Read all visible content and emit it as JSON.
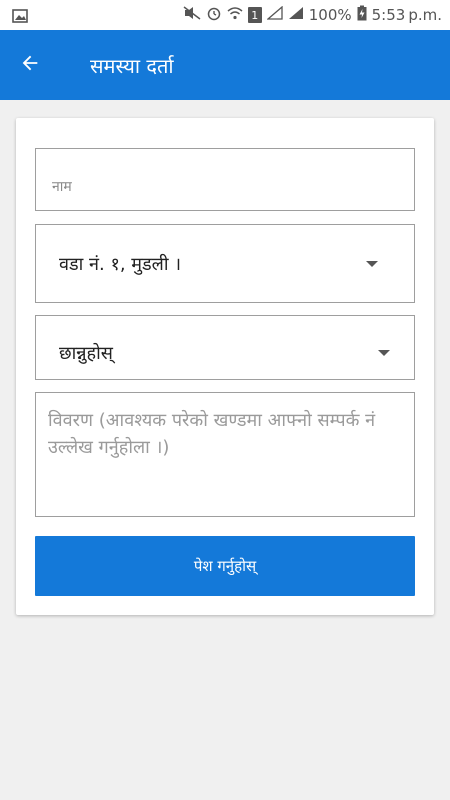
{
  "status_bar": {
    "battery_percent": "100%",
    "time": "5:53",
    "ampm": "p.m.",
    "sim_label": "1",
    "icons": [
      "image-notification-icon",
      "mute-icon",
      "alarm-icon",
      "wifi-icon",
      "sim-icon",
      "signal-icon",
      "battery-charging-icon"
    ]
  },
  "app_bar": {
    "title": "समस्या दर्ता",
    "back_icon": "arrow-back-icon",
    "color": "#1479d9"
  },
  "form": {
    "name_placeholder": "नाम",
    "name_value": "",
    "ward_selected": "वडा नं. १, मुडली ।",
    "category_selected": "छान्नुहोस्",
    "description_placeholder": "विवरण (आवश्यक परेको खण्डमा आफ्नो सम्पर्क नं उल्लेख गर्नुहोला ।)",
    "description_value": "",
    "submit_label": "पेश गर्नुहोस्"
  },
  "colors": {
    "primary": "#1479d9",
    "background": "#f0f0f0",
    "card": "#ffffff"
  }
}
